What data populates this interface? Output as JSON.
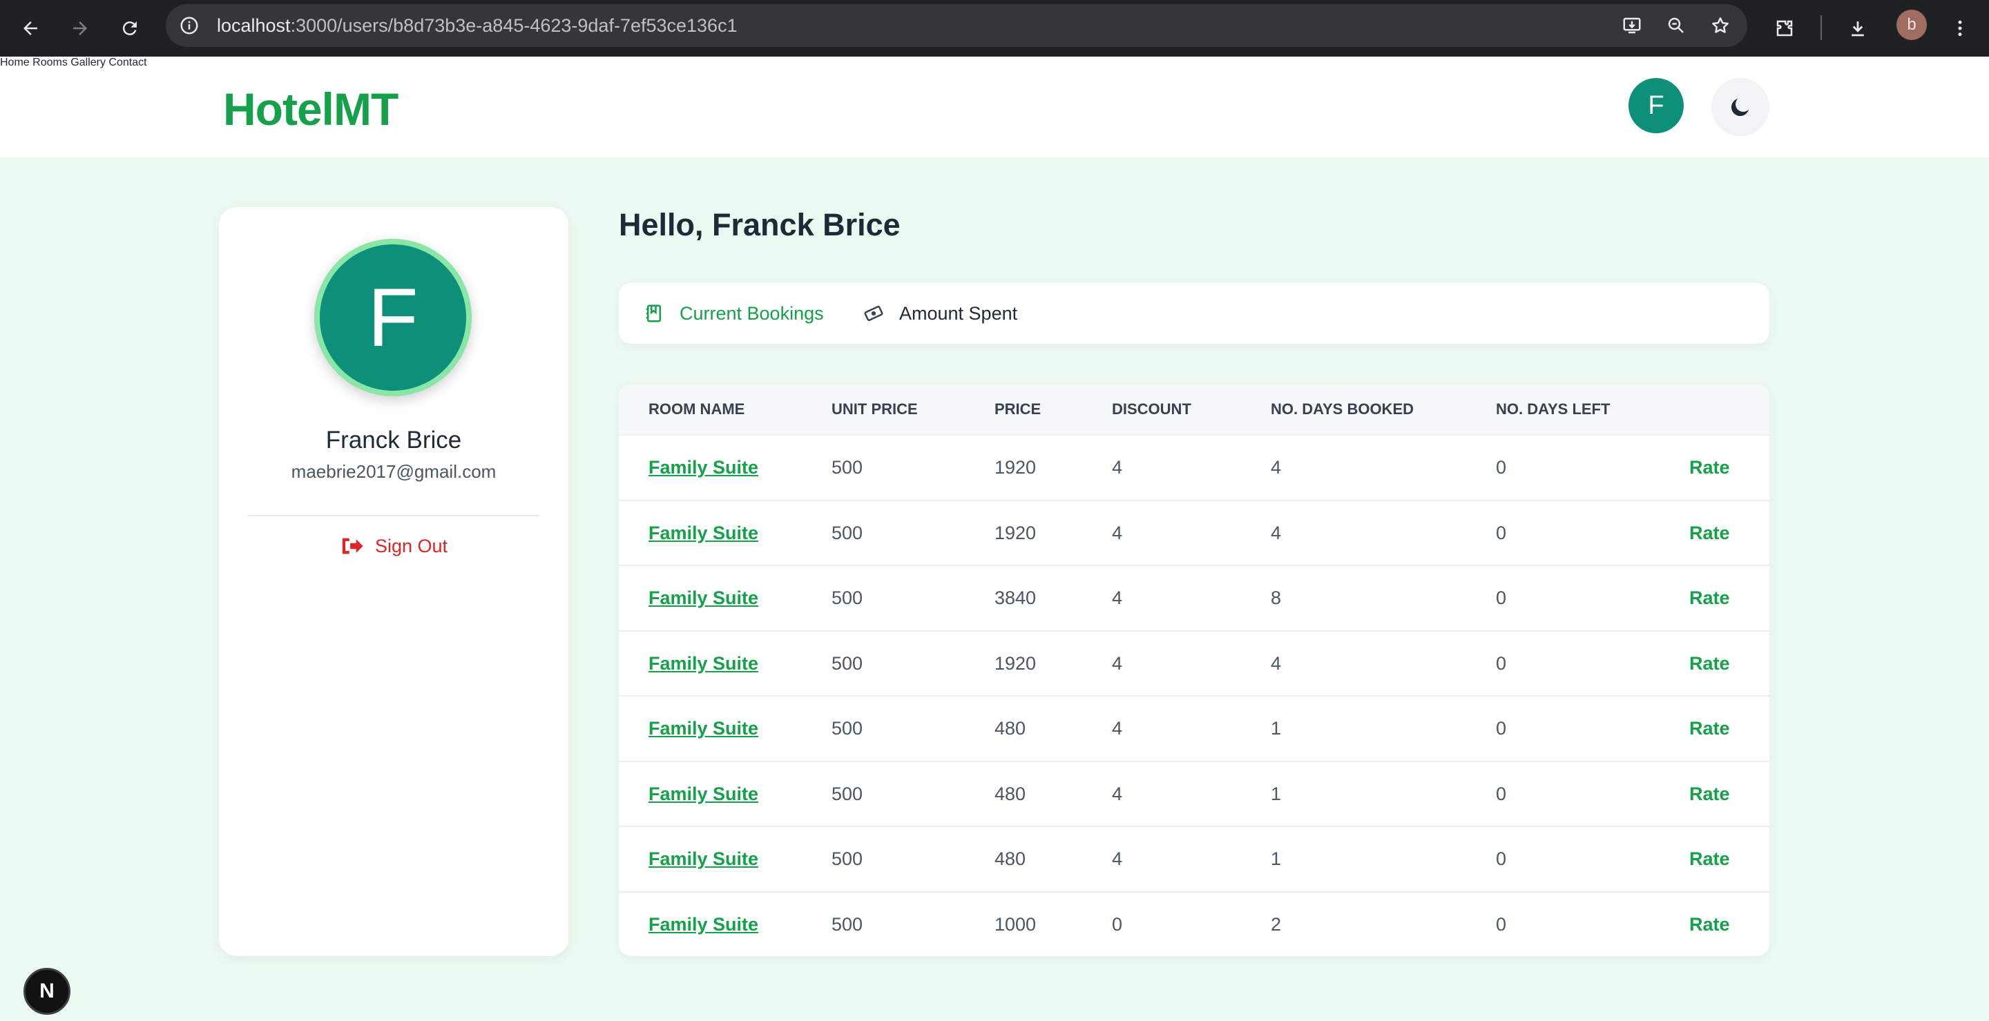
{
  "browser": {
    "url_host": "localhost",
    "url_rest": ":3000/users/b8d73b3e-a845-4623-9daf-7ef53ce136c1",
    "profile_initial": "b"
  },
  "header": {
    "logo": "HotelMT",
    "nav": [
      "Home",
      "Rooms",
      "Gallery",
      "Contact"
    ],
    "avatar_initial": "F"
  },
  "profile": {
    "avatar_initial": "F",
    "name": "Franck Brice",
    "email": "maebrie2017@gmail.com",
    "signout_label": "Sign Out"
  },
  "main": {
    "greeting": "Hello, Franck Brice",
    "tabs": [
      {
        "label": "Current Bookings",
        "active": true,
        "icon": "booking-icon"
      },
      {
        "label": "Amount Spent",
        "active": false,
        "icon": "money-icon"
      }
    ]
  },
  "table": {
    "columns": [
      "ROOM NAME",
      "UNIT PRICE",
      "PRICE",
      "DISCOUNT",
      "NO. DAYS BOOKED",
      "NO. DAYS LEFT"
    ],
    "action_label": "Rate",
    "rows": [
      {
        "room": "Family Suite",
        "unit_price": "500",
        "price": "1920",
        "discount": "4",
        "days_booked": "4",
        "days_left": "0"
      },
      {
        "room": "Family Suite",
        "unit_price": "500",
        "price": "1920",
        "discount": "4",
        "days_booked": "4",
        "days_left": "0"
      },
      {
        "room": "Family Suite",
        "unit_price": "500",
        "price": "3840",
        "discount": "4",
        "days_booked": "8",
        "days_left": "0"
      },
      {
        "room": "Family Suite",
        "unit_price": "500",
        "price": "1920",
        "discount": "4",
        "days_booked": "4",
        "days_left": "0"
      },
      {
        "room": "Family Suite",
        "unit_price": "500",
        "price": "480",
        "discount": "4",
        "days_booked": "1",
        "days_left": "0"
      },
      {
        "room": "Family Suite",
        "unit_price": "500",
        "price": "480",
        "discount": "4",
        "days_booked": "1",
        "days_left": "0"
      },
      {
        "room": "Family Suite",
        "unit_price": "500",
        "price": "480",
        "discount": "4",
        "days_booked": "1",
        "days_left": "0"
      },
      {
        "room": "Family Suite",
        "unit_price": "500",
        "price": "1000",
        "discount": "0",
        "days_booked": "2",
        "days_left": "0"
      }
    ]
  },
  "dev_badge": "N",
  "colors": {
    "brand_green": "#15a04a",
    "avatar_teal": "#0d8f7a",
    "danger_red": "#dc2626"
  }
}
